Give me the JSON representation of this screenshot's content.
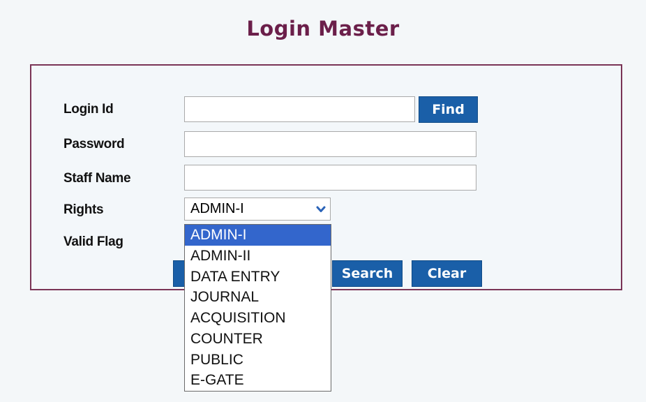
{
  "page": {
    "title": "Login Master"
  },
  "form": {
    "login_id": {
      "label": "Login Id",
      "value": "",
      "placeholder": ""
    },
    "password": {
      "label": "Password",
      "value": "",
      "placeholder": ""
    },
    "staff_name": {
      "label": "Staff Name",
      "value": "",
      "placeholder": ""
    },
    "rights": {
      "label": "Rights",
      "selected": "ADMIN-I",
      "options": [
        "ADMIN-I",
        "ADMIN-II",
        "DATA ENTRY",
        "JOURNAL",
        "ACQUISITION",
        "COUNTER",
        "PUBLIC",
        "E-GATE"
      ],
      "highlighted_index": 0
    },
    "valid_flag": {
      "label": "Valid Flag"
    }
  },
  "buttons": {
    "find": "Find",
    "search": "Search",
    "clear": "Clear"
  },
  "colors": {
    "title": "#6b1f4a",
    "panel_border": "#7a3456",
    "button_bg": "#1a5fa8",
    "option_highlight": "#3366cc"
  },
  "icons": {
    "select_arrow": "chevron-down-icon"
  }
}
